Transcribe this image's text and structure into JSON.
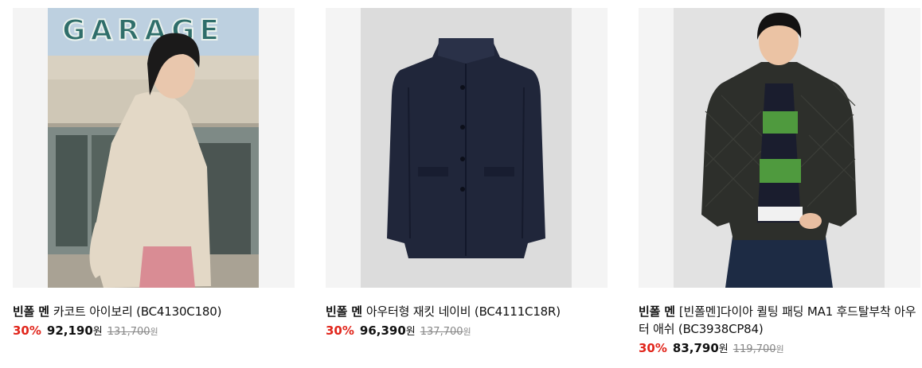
{
  "products": [
    {
      "brand": "빈폴 멘",
      "title": "카코트 아이보리 (BC4130C180)",
      "discount": "30%",
      "price": "92,190",
      "currency": "원",
      "original_price": "131,700",
      "original_currency": "원",
      "photo_sign": "GARAGE"
    },
    {
      "brand": "빈폴 멘",
      "title": "아우터형 재킷 네이비 (BC4111C18R)",
      "discount": "30%",
      "price": "96,390",
      "currency": "원",
      "original_price": "137,700",
      "original_currency": "원"
    },
    {
      "brand": "빈폴 멘",
      "title": "[빈폴멘]다이아 퀼팅 패딩 MA1 후드탈부착 아우터 애쉬 (BC3938CP84)",
      "discount": "30%",
      "price": "83,790",
      "currency": "원",
      "original_price": "119,700",
      "original_currency": "원"
    }
  ],
  "colors": {
    "discount": "#e1261c",
    "thumb_bg": "#f4f4f4",
    "strike": "#888888"
  }
}
